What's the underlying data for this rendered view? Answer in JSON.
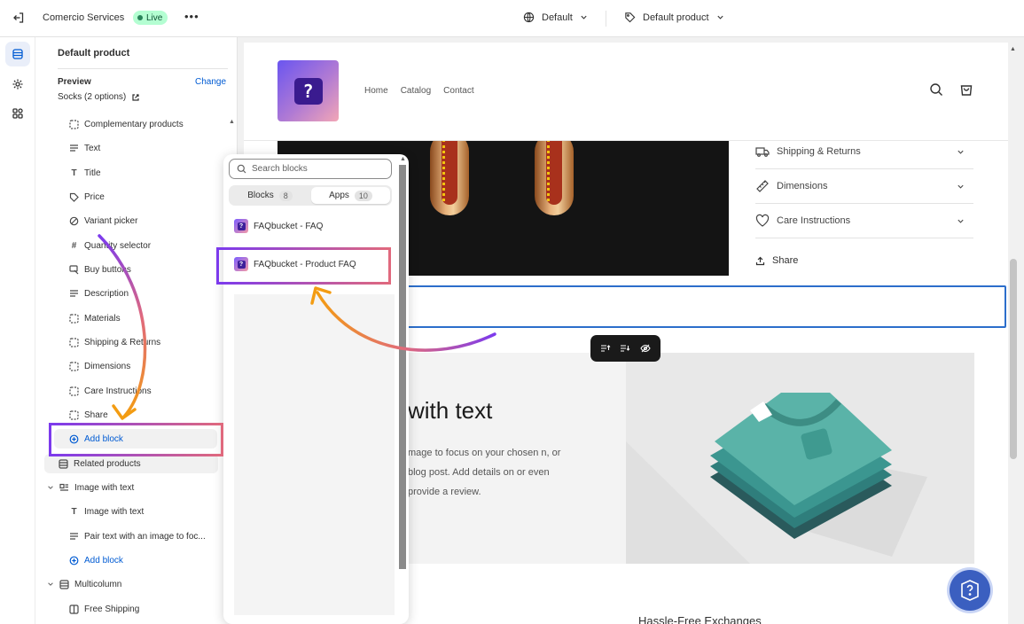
{
  "topbar": {
    "store_name": "Comercio Services",
    "live_label": "Live",
    "more": "•••",
    "theme_selector": "Default",
    "template_selector": "Default product"
  },
  "sidebar": {
    "title": "Default product",
    "preview_label": "Preview",
    "change_label": "Change",
    "preview_value": "Socks (2 options)",
    "items": [
      {
        "label": "Complementary products",
        "icon": "dashed-square-icon"
      },
      {
        "label": "Text",
        "icon": "text-align-icon"
      },
      {
        "label": "Title",
        "icon": "title-t-icon"
      },
      {
        "label": "Price",
        "icon": "price-tag-icon"
      },
      {
        "label": "Variant picker",
        "icon": "variant-icon"
      },
      {
        "label": "Quantity selector",
        "icon": "hash-icon"
      },
      {
        "label": "Buy buttons",
        "icon": "cursor-icon"
      },
      {
        "label": "Description",
        "icon": "text-align-icon"
      },
      {
        "label": "Materials",
        "icon": "dashed-square-icon"
      },
      {
        "label": "Shipping & Returns",
        "icon": "dashed-square-icon"
      },
      {
        "label": "Dimensions",
        "icon": "dashed-square-icon"
      },
      {
        "label": "Care Instructions",
        "icon": "dashed-square-icon"
      },
      {
        "label": "Share",
        "icon": "dashed-square-icon"
      }
    ],
    "add_block": "Add block",
    "related_products": "Related products",
    "image_with_text_section": "Image with text",
    "image_with_text_items": [
      {
        "label": "Image with text",
        "icon": "title-t-icon"
      },
      {
        "label": "Pair text with an image to foc...",
        "icon": "text-align-icon"
      }
    ],
    "add_block_2": "Add block",
    "multicolumn_section": "Multicolumn",
    "multicolumn_items": [
      {
        "label": "Free Shipping",
        "icon": "column-icon"
      }
    ]
  },
  "popup": {
    "search_placeholder": "Search blocks",
    "tabs": [
      {
        "label": "Blocks",
        "count": "8"
      },
      {
        "label": "Apps",
        "count": "10"
      }
    ],
    "apps": [
      {
        "label": "FAQbucket - FAQ"
      },
      {
        "label": "FAQbucket - Product FAQ"
      }
    ]
  },
  "preview": {
    "logo_glyph": "?",
    "nav": [
      "Home",
      "Catalog",
      "Contact"
    ],
    "accordion": [
      {
        "label": "Shipping & Returns",
        "icon": "truck-icon"
      },
      {
        "label": "Dimensions",
        "icon": "ruler-icon"
      },
      {
        "label": "Care Instructions",
        "icon": "heart-icon"
      }
    ],
    "share_label": "Share",
    "iwt_title": "with text",
    "iwt_text": "mage to focus on your chosen n, or blog post. Add details on or even provide a review.",
    "bottom_heading": "Hassle-Free Exchanges"
  },
  "colors": {
    "accent_blue": "#005bd3",
    "live_green": "#b4fed2",
    "highlight_gradient_start": "#7c3aed",
    "highlight_gradient_end": "#e0697d",
    "arrow_orange": "#f39c12"
  }
}
